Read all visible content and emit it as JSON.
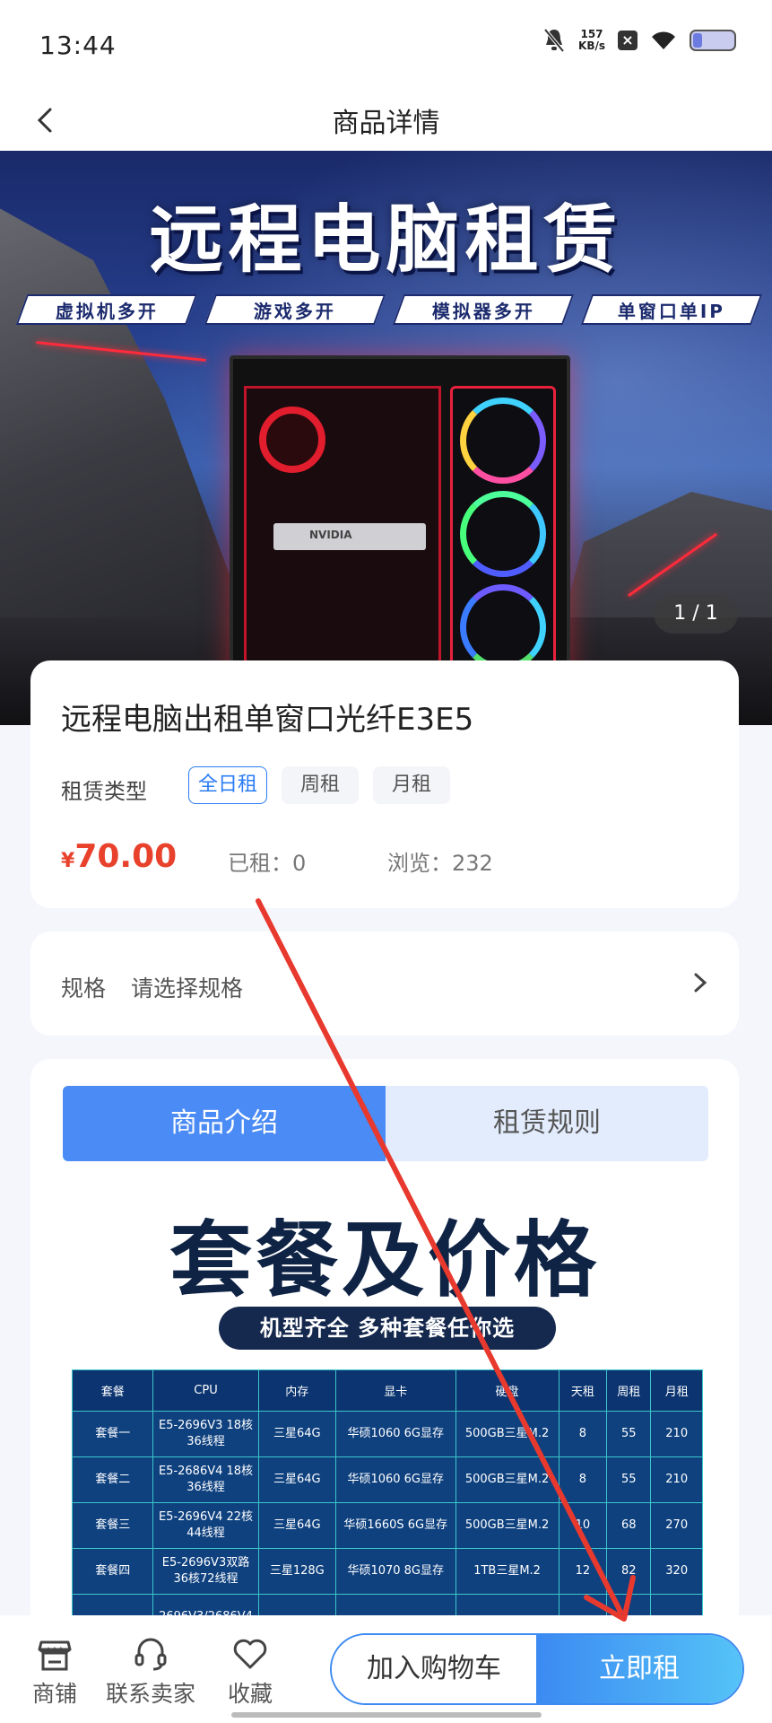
{
  "status_bar": {
    "time": "13:44",
    "speed_value": "157",
    "speed_unit": "KB/s"
  },
  "nav": {
    "title": "商品详情"
  },
  "banner": {
    "headline": "远程电脑租赁",
    "features": [
      "虚拟机多开",
      "游戏多开",
      "模拟器多开",
      "单窗口单IP"
    ],
    "gpu_label": "NVIDIA",
    "pager": "1 / 1"
  },
  "product": {
    "title": "远程电脑出租单窗口光纤E3E5",
    "rent_type_label": "租赁类型",
    "rent_types": [
      "全日租",
      "周租",
      "月租"
    ],
    "currency": "¥",
    "price": "70.00",
    "rented": "已租：0",
    "views": "浏览：232"
  },
  "spec": {
    "label": "规格",
    "value": "请选择规格"
  },
  "tabs": [
    "商品介绍",
    "租赁规则"
  ],
  "detail": {
    "title": "套餐及价格",
    "subtitle": "机型齐全 多种套餐任你选",
    "table_headers": [
      "套餐",
      "CPU",
      "内存",
      "显卡",
      "硬盘",
      "天租",
      "周租",
      "月租"
    ],
    "table_rows": [
      [
        "套餐一",
        "E5-2696V3 18核36线程",
        "三星64G",
        "华硕1060 6G显存",
        "500GB三星M.2",
        "8",
        "55",
        "210"
      ],
      [
        "套餐二",
        "E5-2686V4 18核36线程",
        "三星64G",
        "华硕1060 6G显存",
        "500GB三星M.2",
        "8",
        "55",
        "210"
      ],
      [
        "套餐三",
        "E5-2696V4 22核44线程",
        "三星64G",
        "华硕1660S 6G显存",
        "500GB三星M.2",
        "10",
        "68",
        "270"
      ],
      [
        "套餐四",
        "E5-2696V3双路 36核72线程",
        "三星128G",
        "华硕1070 8G显存",
        "1TB三星M.2",
        "12",
        "82",
        "320"
      ],
      [
        "",
        "2696V3/2686V4",
        "",
        "",
        "",
        "",
        "",
        ""
      ]
    ]
  },
  "bottom_bar": {
    "shop": "商铺",
    "contact": "联系卖家",
    "favorite": "收藏",
    "add_cart": "加入购物车",
    "rent_now": "立即租"
  },
  "colors": {
    "accent": "#2b7cf6",
    "price": "#e8412c",
    "arrow": "#e8392e"
  }
}
